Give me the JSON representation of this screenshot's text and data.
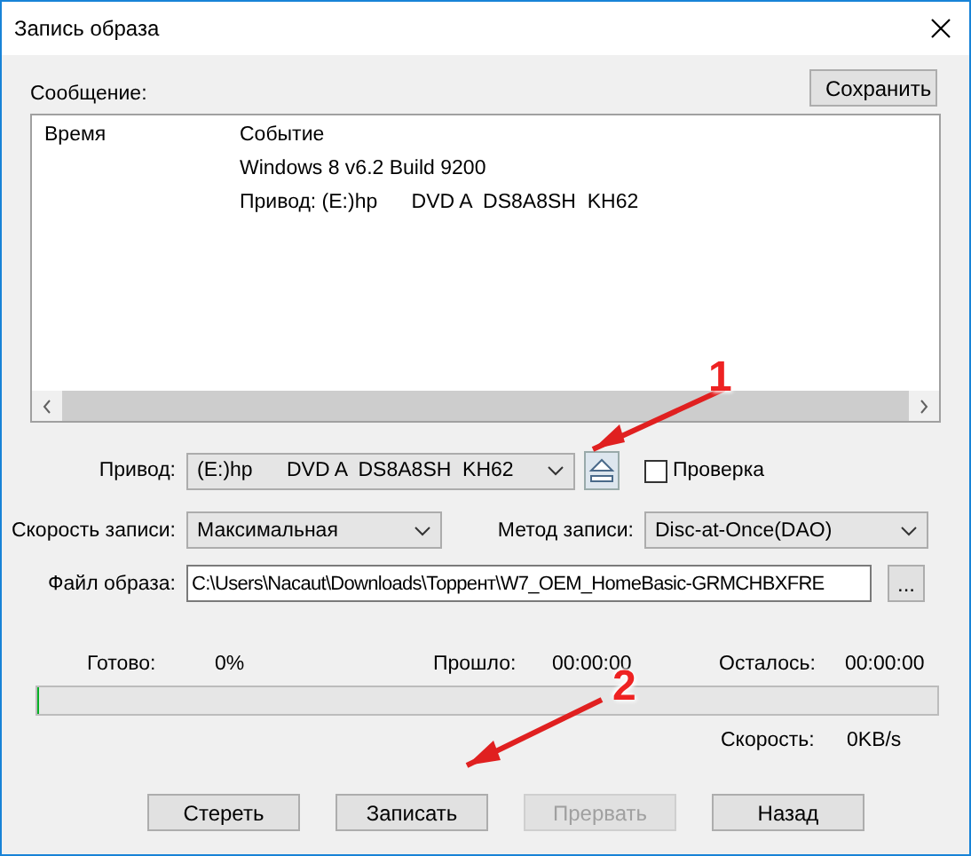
{
  "window": {
    "title": "Запись образа"
  },
  "log": {
    "label": "Сообщение:",
    "save_button": "Сохранить",
    "columns": [
      "Время",
      "Событие"
    ],
    "events": [
      "Windows 8 v6.2 Build 9200",
      "Привод: (E:)hp      DVD A  DS8A8SH  KH62"
    ]
  },
  "drive": {
    "label": "Привод:",
    "value": "(E:)hp      DVD A  DS8A8SH  KH62",
    "verify": {
      "label": "Проверка",
      "checked": false
    }
  },
  "speed": {
    "label": "Скорость записи:",
    "value": "Максимальная"
  },
  "method": {
    "label": "Метод записи:",
    "value": "Disc-at-Once(DAO)"
  },
  "file": {
    "label": "Файл образа:",
    "value": "C:\\Users\\Nacaut\\Downloads\\Торрент\\W7_OEM_HomeBasic-GRMCHBXFRE",
    "browse": "..."
  },
  "status": {
    "ready_label": "Готово:",
    "ready_value": "0%",
    "elapsed_label": "Прошло:",
    "elapsed_value": "00:00:00",
    "remaining_label": "Осталось:",
    "remaining_value": "00:00:00",
    "level": 0,
    "speed_label": "Скорость:",
    "speed_value": "0KB/s"
  },
  "buttons": [
    {
      "label": "Стереть",
      "disabled": false
    },
    {
      "label": "Записать",
      "disabled": false
    },
    {
      "label": "Прервать",
      "disabled": true
    },
    {
      "label": "Назад",
      "disabled": false
    }
  ],
  "annotations": [
    {
      "label": "1"
    },
    {
      "label": "2"
    }
  ]
}
